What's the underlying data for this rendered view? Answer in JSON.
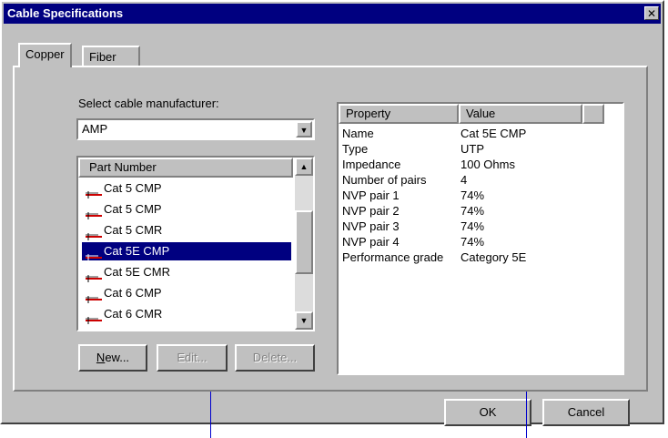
{
  "window": {
    "title": "Cable Specifications"
  },
  "tabs": [
    {
      "label": "Copper",
      "active": true
    },
    {
      "label": "Fiber",
      "active": false
    }
  ],
  "manufacturer": {
    "label": "Select cable manufacturer:",
    "selected": "AMP"
  },
  "part_list": {
    "header": "Part Number",
    "items": [
      {
        "label": "Cat 5 CMP",
        "selected": false
      },
      {
        "label": "Cat 5 CMP",
        "selected": false
      },
      {
        "label": "Cat 5 CMR",
        "selected": false
      },
      {
        "label": "Cat 5E CMP",
        "selected": true
      },
      {
        "label": "Cat 5E CMR",
        "selected": false
      },
      {
        "label": "Cat 6 CMP",
        "selected": false
      },
      {
        "label": "Cat 6 CMR",
        "selected": false
      }
    ]
  },
  "list_buttons": {
    "new_label": "New...",
    "edit_label": "Edit...",
    "delete_label": "Delete..."
  },
  "properties": {
    "headers": {
      "property": "Property",
      "value": "Value"
    },
    "rows": [
      {
        "property": "Name",
        "value": "Cat 5E CMP"
      },
      {
        "property": "Type",
        "value": "UTP"
      },
      {
        "property": "Impedance",
        "value": "100 Ohms"
      },
      {
        "property": "Number of pairs",
        "value": "4"
      },
      {
        "property": "NVP pair 1",
        "value": "74%"
      },
      {
        "property": "NVP pair 2",
        "value": "74%"
      },
      {
        "property": "NVP pair 3",
        "value": "74%"
      },
      {
        "property": "NVP pair 4",
        "value": "74%"
      },
      {
        "property": "Performance grade",
        "value": "Category 5E"
      }
    ]
  },
  "dialog_buttons": {
    "ok_label": "OK",
    "cancel_label": "Cancel"
  },
  "colors": {
    "title_bar": "#000080",
    "selection": "#000080",
    "face": "#c0c0c0",
    "leader_line": "#0000cc"
  }
}
